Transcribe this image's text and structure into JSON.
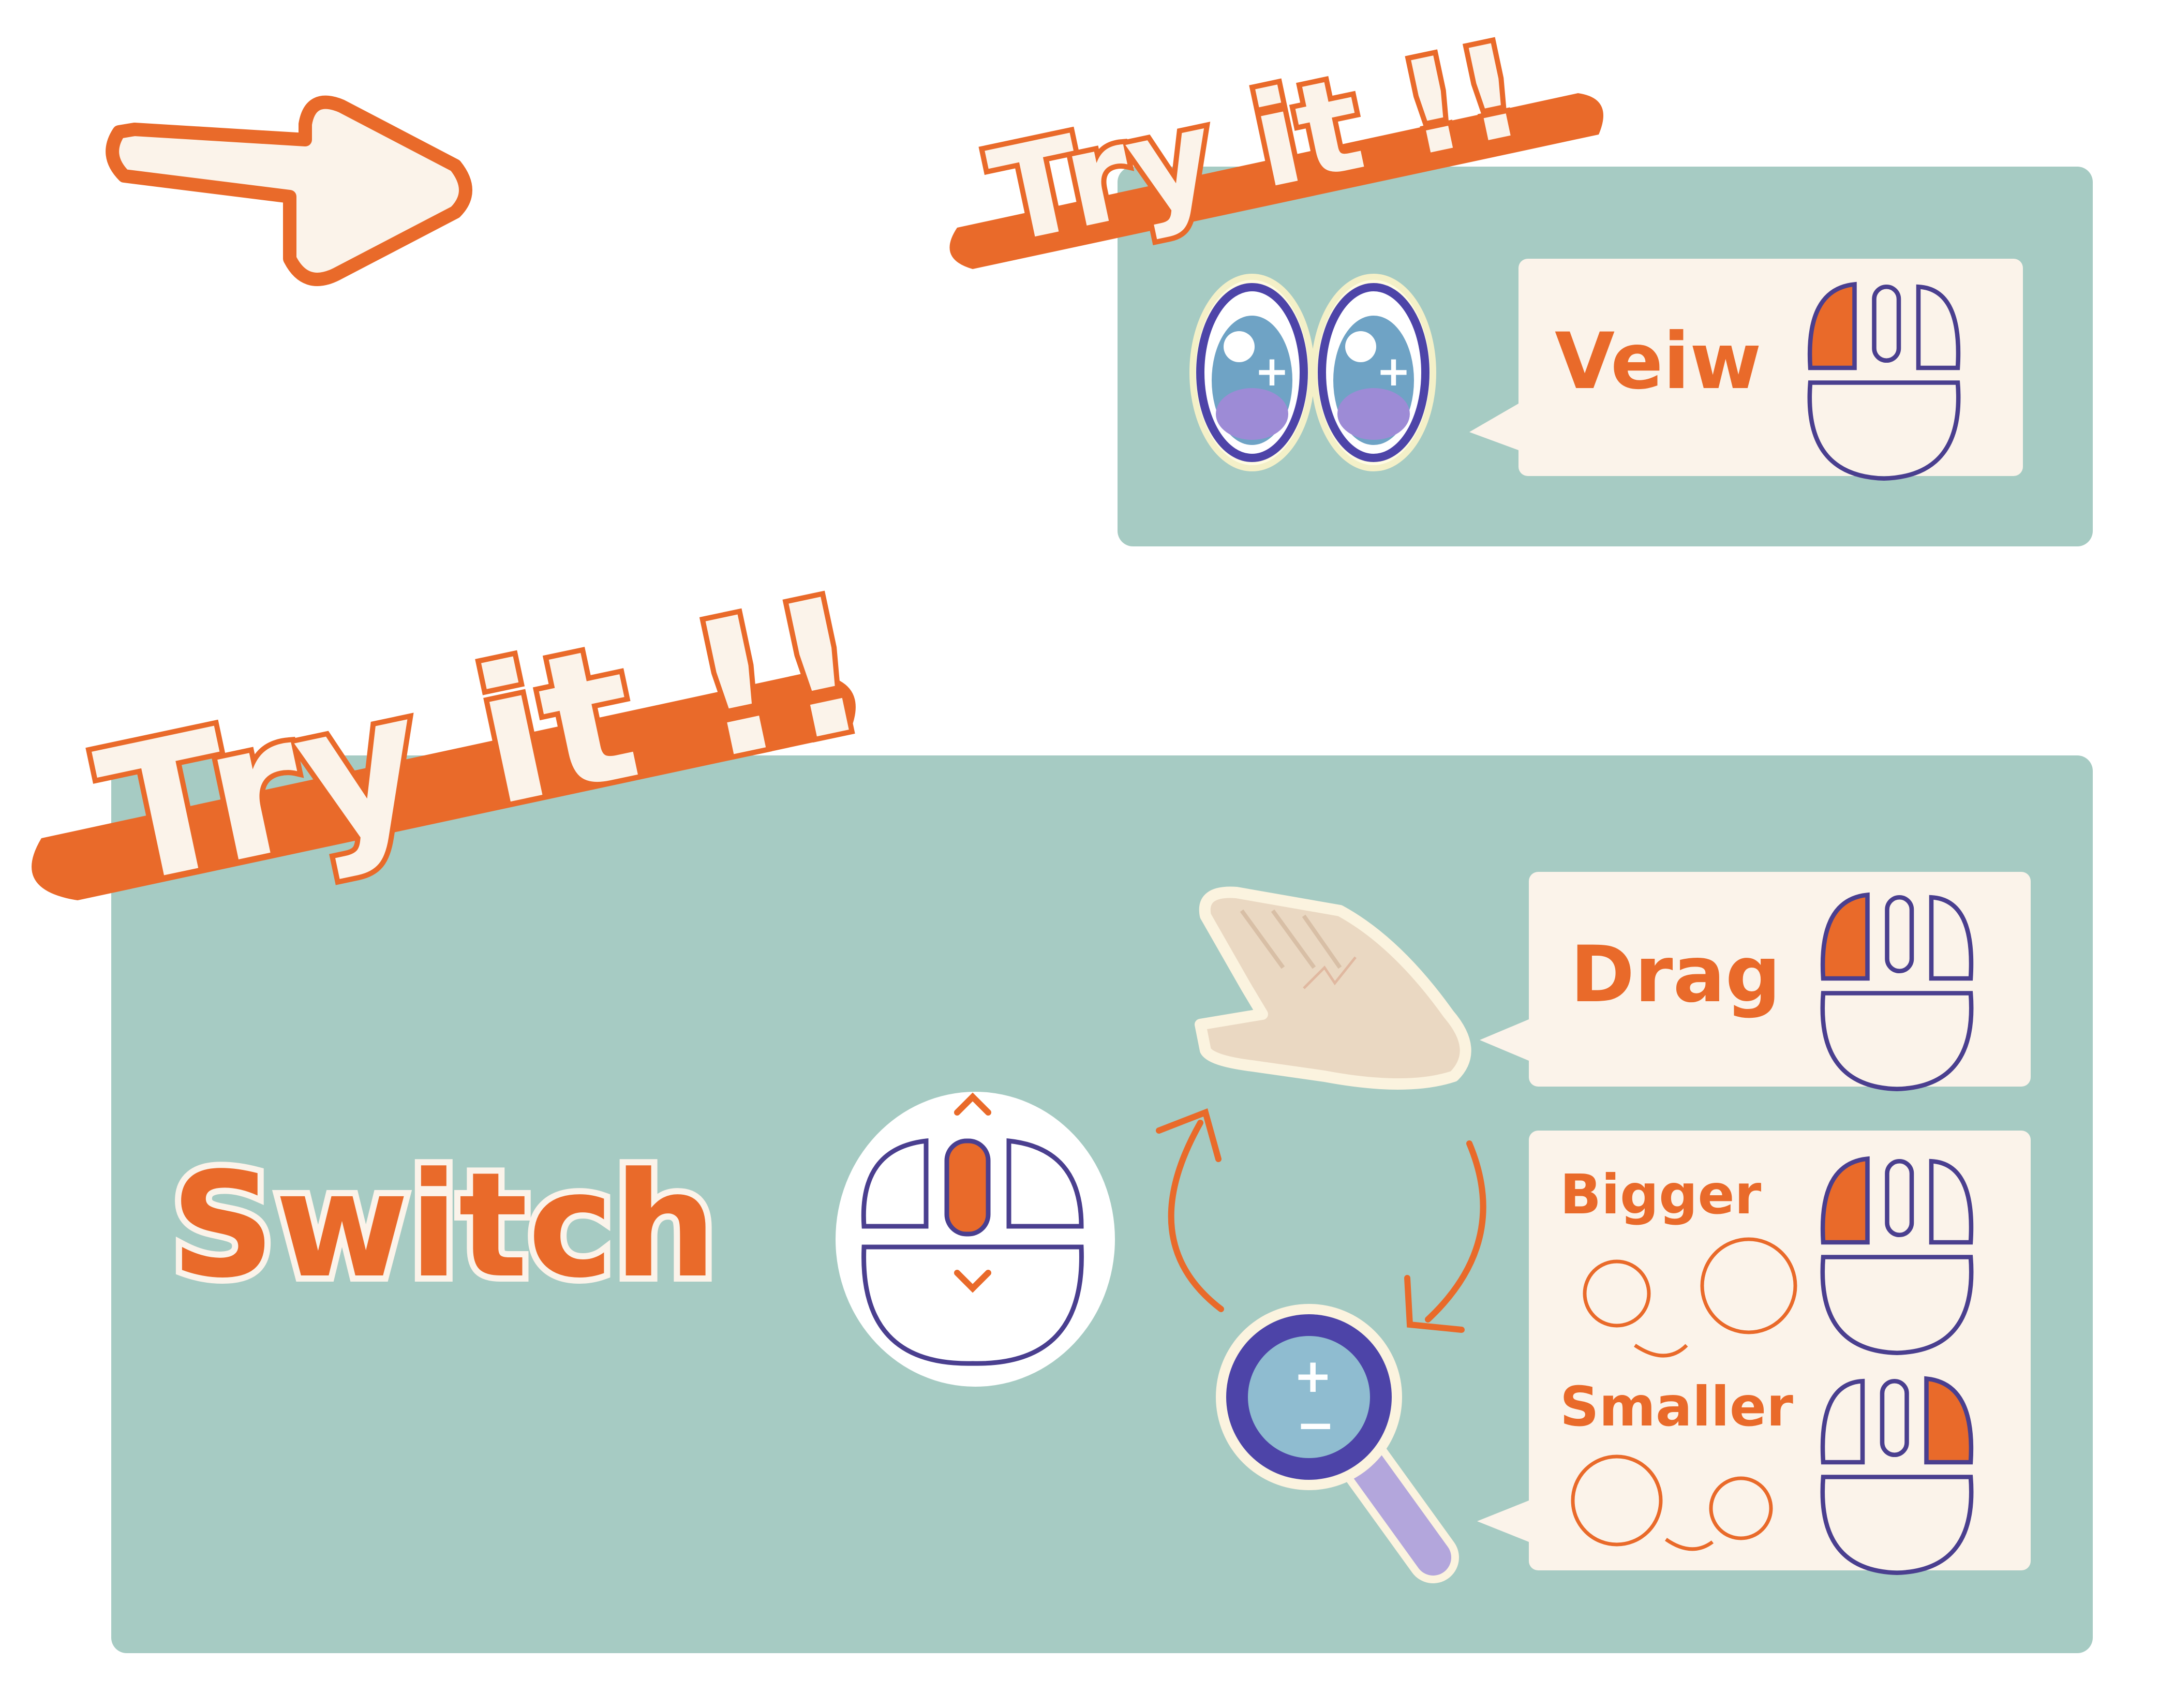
{
  "colors": {
    "panel": "#a6cbc3",
    "accent": "#e96a2a",
    "cream": "#fbf3ea",
    "ink": "#4a3f8f"
  },
  "top_panel": {
    "title": "Try it !!",
    "view_label": "Veiw",
    "icons": [
      "arrow-icon",
      "eyes-icon",
      "mouse-left-click-icon"
    ]
  },
  "main_panel": {
    "title": "Try it !!",
    "switch_label": "Switch",
    "drag_label": "Drag",
    "bigger_label": "Bigger",
    "smaller_label": "Smaller",
    "icons": [
      "mouse-scroll-icon",
      "hand-icon",
      "magnifier-icon",
      "cycle-arrow-icon",
      "mouse-left-click-icon",
      "mouse-right-click-icon"
    ]
  }
}
